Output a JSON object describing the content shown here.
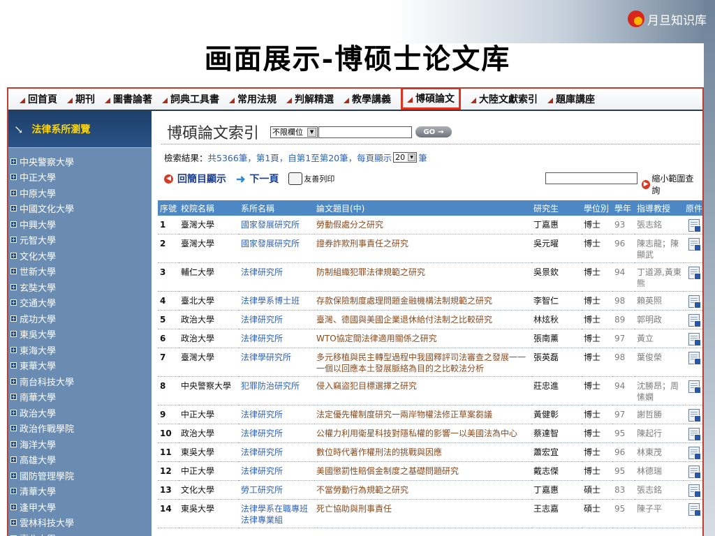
{
  "brand": {
    "name": "月旦知识库"
  },
  "slide": {
    "title": "画面展示-博硕士论文库"
  },
  "nav": {
    "items": [
      "回首頁",
      "期刊",
      "圖書論著",
      "詞典工具書",
      "常用法規",
      "判解精選",
      "教學講義",
      "博碩論文",
      "大陸文獻索引",
      "題庫講座"
    ],
    "active": "博碩論文"
  },
  "sidebar": {
    "header": "法律系所瀏覽",
    "items": [
      "中央警察大學",
      "中正大學",
      "中原大學",
      "中國文化大學",
      "中興大學",
      "元智大學",
      "文化大學",
      "世新大學",
      "玄奘大學",
      "交通大學",
      "成功大學",
      "東吳大學",
      "東海大學",
      "東華大學",
      "南台科技大學",
      "南華大學",
      "政治大學",
      "政治作戰學院",
      "海洋大學",
      "高雄大學",
      "國防管理學院",
      "清華大學",
      "逢甲大學",
      "雲林科技大學",
      "臺北大學"
    ]
  },
  "search": {
    "page_title": "博碩論文索引",
    "field_select": "不限欄位",
    "input_value": "",
    "go_label": "GO"
  },
  "results": {
    "label": "檢索結果：",
    "summary": "共5366筆，第1頁，自第1至第20筆，每頁顯示",
    "per_page": "20",
    "unit": "筆"
  },
  "actions": {
    "back": "回簡目顯示",
    "next": "下一頁",
    "print": "友善列印",
    "narrow_input": "",
    "narrow": "縮小範圍查詢"
  },
  "table": {
    "headers": [
      "序號",
      "校院名稱",
      "系所名稱",
      "論文題目(中)",
      "研究生",
      "學位別",
      "學年",
      "指導教授",
      "原件"
    ],
    "rows": [
      [
        "1",
        "臺灣大學",
        "國家發展研究所",
        "勞動假處分之研究",
        "丁嘉惠",
        "博士",
        "93",
        "張志銘"
      ],
      [
        "2",
        "臺灣大學",
        "國家發展研究所",
        "證券詐欺刑事責任之研究",
        "吳元曜",
        "博士",
        "96",
        "陳志龍；陳顯武"
      ],
      [
        "3",
        "輔仁大學",
        "法律研究所",
        "防制組織犯罪法律規範之研究",
        "吳景欽",
        "博士",
        "94",
        "丁道源,黃東熊"
      ],
      [
        "4",
        "臺北大學",
        "法律學系博士班",
        "存款保險制度處理問題金融機構法制規範之研究",
        "李智仁",
        "博士",
        "98",
        "賴英照"
      ],
      [
        "5",
        "政治大學",
        "法律研究所",
        "臺灣、德國與美國企業退休給付法制之比較研究",
        "林炫秋",
        "博士",
        "89",
        "郭明政"
      ],
      [
        "6",
        "政治大學",
        "法律研究所",
        "WTO協定間法律適用關係之研究",
        "張南薰",
        "博士",
        "97",
        "黃立"
      ],
      [
        "7",
        "臺灣大學",
        "法律學研究所",
        "多元移植與民主轉型過程中我國釋評司法審查之發展一一一個以回應本土發展脈絡為目的之比較法分析",
        "張英磊",
        "博士",
        "98",
        "葉俊榮"
      ],
      [
        "8",
        "中央警察大學",
        "犯罪防治研究所",
        "侵入竊盜犯目標選擇之研究",
        "莊忠進",
        "博士",
        "94",
        "沈勝昂；周愫嫻"
      ],
      [
        "9",
        "中正大學",
        "法律研究所",
        "法定優先權制度研究一兩岸物權法修正草案芻議",
        "黃健彰",
        "博士",
        "97",
        "謝哲勝"
      ],
      [
        "10",
        "政治大學",
        "法律研究所",
        "公權力利用衛星科技對隱私權的影響一以美國法為中心",
        "蔡達智",
        "博士",
        "95",
        "陳起行"
      ],
      [
        "11",
        "東吳大學",
        "法律研究所",
        "數位時代著作權刑法的挑戰與因應",
        "蕭宏宜",
        "博士",
        "96",
        "林東茂"
      ],
      [
        "12",
        "中正大學",
        "法律研究所",
        "美國懲罰性賠償金制度之基礎問題研究",
        "戴志傑",
        "博士",
        "95",
        "林德瑞"
      ],
      [
        "13",
        "文化大學",
        "勞工研究所",
        "不當勞動行為規範之研究",
        "丁嘉惠",
        "碩士",
        "83",
        "張志銘"
      ],
      [
        "14",
        "東吳大學",
        "法律學系在職專班法律專業組",
        "死亡協助與刑事責任",
        "王志嘉",
        "碩士",
        "95",
        "陳子平"
      ]
    ]
  },
  "colors": {
    "nav_active_border": "#e03420",
    "sidebar_bg": "#6a8cb3",
    "table_header": "#4d88c4",
    "link_blue": "#2f63b5"
  }
}
